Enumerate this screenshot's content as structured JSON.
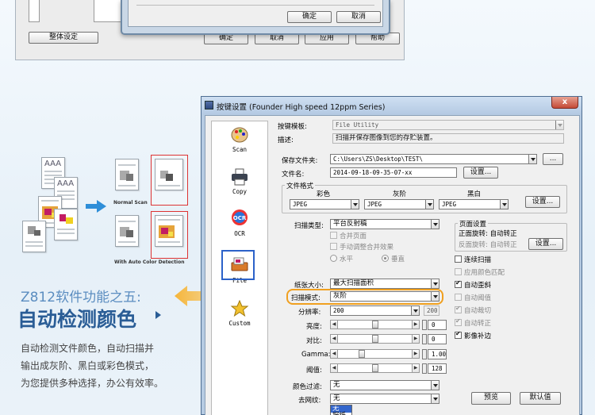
{
  "top_dialog": {
    "ok_label": "确定",
    "cancel_label": "取消",
    "overall_settings": "整体设定",
    "footer_buttons": [
      "确定",
      "取消",
      "应用",
      "帮助"
    ]
  },
  "illustration": {
    "doc_text": "AAA",
    "normal_scan_caption": "Normal Scan",
    "auto_color_caption": "With Auto Color Detection"
  },
  "feature": {
    "title": "Z812软件功能之五:",
    "headline": "自动检测颜色",
    "desc_lines": [
      "自动检测文件颜色，自动扫描并",
      "输出成灰阶、黑白或彩色模式，",
      "为您提供多种选择，办公有效率。"
    ]
  },
  "dialog": {
    "title": "按键设置 (Founder High speed 12ppm Series)",
    "close": "x",
    "sidebar": [
      {
        "label": "Scan",
        "icon": "palette-icon"
      },
      {
        "label": "Copy",
        "icon": "printer-icon"
      },
      {
        "label": "OCR",
        "icon": "ocr-icon"
      },
      {
        "label": "File",
        "icon": "file-scanner-icon"
      },
      {
        "label": "Custom",
        "icon": "star-icon"
      }
    ],
    "template_label": "按键模板:",
    "template_value": "File Utility",
    "desc_label": "描述:",
    "desc_value": "扫描并保存图像到您的存贮装置。",
    "save_folder_label": "保存文件夹:",
    "save_folder_value": "C:\\Users\\ZS\\Desktop\\TEST\\",
    "browse_label": "...",
    "filename_label": "文件名:",
    "filename_value": "2014-09-18-09-35-07-xx",
    "settings_btn": "设置...",
    "file_format": {
      "title": "文件格式",
      "cols": [
        "彩色",
        "灰阶",
        "黑白"
      ],
      "values": [
        "JPEG",
        "JPEG",
        "JPEG"
      ],
      "settings_btn": "设置..."
    },
    "scan_type_label": "扫描类型:",
    "scan_type_value": "平台反射稿",
    "merge_page": "合并页面",
    "manual_merge": "手动调整合并效果",
    "horizontal": "水平",
    "vertical": "垂直",
    "page_settings": {
      "title": "页面设置",
      "front_rotate": "正面旋转: 自动转正",
      "back_rotate": "反面旋转: 自动转正",
      "settings_btn": "设置..."
    },
    "checkboxes": [
      {
        "label": "连续扫描",
        "checked": false,
        "enabled": true
      },
      {
        "label": "应用颜色匹配",
        "checked": false,
        "enabled": false
      },
      {
        "label": "自动歪斜",
        "checked": true,
        "enabled": true
      },
      {
        "label": "自动阈值",
        "checked": false,
        "enabled": false
      },
      {
        "label": "自动裁切",
        "checked": true,
        "enabled": false
      },
      {
        "label": "自动转正",
        "checked": true,
        "enabled": false
      },
      {
        "label": "影像补边",
        "checked": true,
        "enabled": true
      }
    ],
    "paper_size_label": "纸张大小:",
    "paper_size_value": "最大扫描面积",
    "scan_mode_label": "扫描模式:",
    "scan_mode_value": "灰阶",
    "scan_mode_num": "200",
    "resolution_label": "分辨率:",
    "resolution_value": "200",
    "brightness_label": "亮度:",
    "brightness_value": "0",
    "brightness_level": 0.5,
    "contrast_label": "对比:",
    "contrast_value": "0",
    "contrast_level": 0.5,
    "gamma_label": "Gamma:",
    "gamma_value": "1.00",
    "gamma_level": 0.3,
    "threshold_label": "阈值:",
    "threshold_value": "128",
    "threshold_level": 0.5,
    "color_filter_label": "颜色过滤:",
    "color_filter_value": "无",
    "descreen_label": "去网纹:",
    "descreen_value": "无",
    "descreen_options": [
      "无",
      "报纸"
    ],
    "preview_btn": "预览",
    "default_btn": "默认值"
  }
}
